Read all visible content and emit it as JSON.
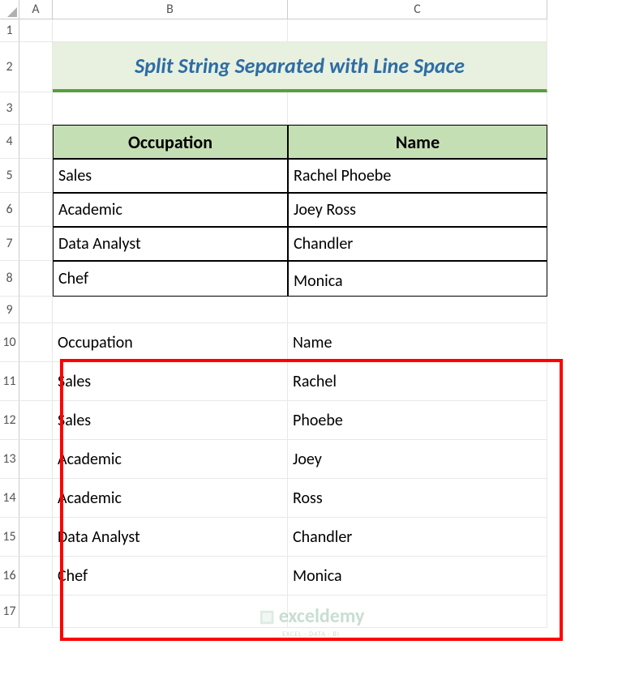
{
  "columns": [
    "A",
    "B",
    "C"
  ],
  "rows": [
    "1",
    "2",
    "3",
    "4",
    "5",
    "6",
    "7",
    "8",
    "9",
    "10",
    "11",
    "12",
    "13",
    "14",
    "15",
    "16",
    "17"
  ],
  "title": "Split String Separated with Line Space",
  "table": {
    "headers": {
      "occupation": "Occupation",
      "name": "Name"
    },
    "rows": [
      {
        "occupation": "Sales",
        "name": "Rachel Phoebe"
      },
      {
        "occupation": "Academic",
        "name": "Joey Ross"
      },
      {
        "occupation": "Data Analyst",
        "name": "Chandler"
      },
      {
        "occupation": "Chef",
        "name": "Monica"
      }
    ]
  },
  "result": {
    "header": {
      "occupation": "Occupation",
      "name": "Name"
    },
    "rows": [
      {
        "occupation": "Sales",
        "name": "Rachel"
      },
      {
        "occupation": "Sales",
        "name": "Phoebe"
      },
      {
        "occupation": "Academic",
        "name": "Joey"
      },
      {
        "occupation": "Academic",
        "name": "Ross"
      },
      {
        "occupation": "Data Analyst",
        "name": "Chandler"
      },
      {
        "occupation": "Chef",
        "name": "Monica"
      }
    ]
  },
  "watermark": {
    "text": "exceldemy",
    "sub": "EXCEL · DATA · BI"
  }
}
